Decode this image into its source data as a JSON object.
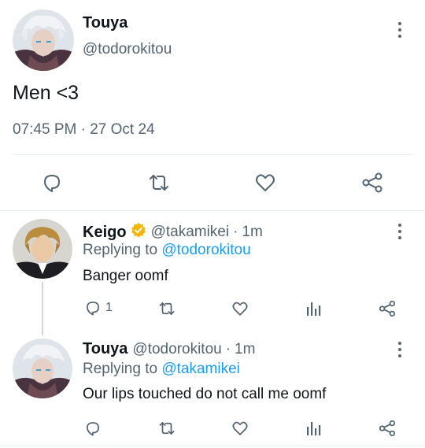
{
  "main_tweet": {
    "display_name": "Touya",
    "handle": "@todorokitou",
    "text": "Men <3",
    "timestamp": "07:45 PM · 27 Oct 24",
    "actions": [
      "reply-icon",
      "retweet-icon",
      "like-icon",
      "share-icon"
    ]
  },
  "replies": [
    {
      "display_name": "Keigo",
      "verified": true,
      "handle": "@takamikei",
      "time_sep": "·",
      "time": "1m",
      "replying_prefix": "Replying to",
      "replying_to": "@todorokitou",
      "text": "Banger oomf",
      "reply_count": "1"
    },
    {
      "display_name": "Touya",
      "verified": false,
      "handle": "@todorokitou",
      "time_sep": "·",
      "time": "1m",
      "replying_prefix": "Replying to",
      "replying_to": "@takamikei",
      "text": "Our lips touched do not call me oomf",
      "reply_count": ""
    }
  ],
  "colors": {
    "text": "#0f1419",
    "muted": "#536471",
    "link": "#1d9bf0",
    "verified": "#f4b400",
    "divider": "#e6ecf0"
  }
}
